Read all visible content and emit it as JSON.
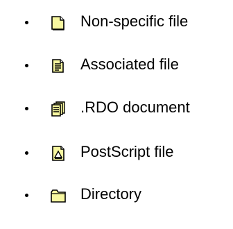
{
  "colors": {
    "icon_fill": "#f7f7a0",
    "icon_stroke": "#000000",
    "text": "#000000",
    "background": "#ffffff"
  },
  "file_types": [
    {
      "icon": "blank-page-icon",
      "label": "Non-specific file"
    },
    {
      "icon": "text-page-icon",
      "label": "Associated file"
    },
    {
      "icon": "multi-page-document-icon",
      "label": ".RDO document"
    },
    {
      "icon": "postscript-page-icon",
      "label": "PostScript file"
    },
    {
      "icon": "folder-icon",
      "label": "Directory"
    }
  ]
}
